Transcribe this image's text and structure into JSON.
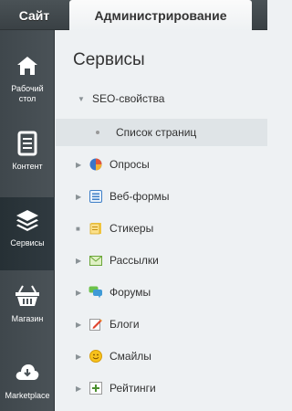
{
  "tabs": {
    "site": "Сайт",
    "admin": "Администрирование"
  },
  "left_menu": [
    {
      "label": "Рабочий\nстол",
      "icon": "home-icon"
    },
    {
      "label": "Контент",
      "icon": "document-icon"
    },
    {
      "label": "Сервисы",
      "icon": "layers-icon",
      "active": true
    },
    {
      "label": "Магазин",
      "icon": "basket-icon"
    },
    {
      "label": "Marketplace",
      "icon": "cloud-download-icon"
    }
  ],
  "panel": {
    "title": "Сервисы",
    "items": [
      {
        "label": "SEO-свойства",
        "expanded": true
      },
      {
        "label": "Список страниц",
        "selected": true
      },
      {
        "label": "Опросы",
        "icon": "poll-icon"
      },
      {
        "label": "Веб-формы",
        "icon": "form-icon"
      },
      {
        "label": "Стикеры",
        "icon": "sticker-icon"
      },
      {
        "label": "Рассылки",
        "icon": "mail-icon"
      },
      {
        "label": "Форумы",
        "icon": "forum-icon"
      },
      {
        "label": "Блоги",
        "icon": "blog-icon"
      },
      {
        "label": "Смайлы",
        "icon": "smile-icon"
      },
      {
        "label": "Рейтинги",
        "icon": "rating-icon"
      }
    ]
  }
}
